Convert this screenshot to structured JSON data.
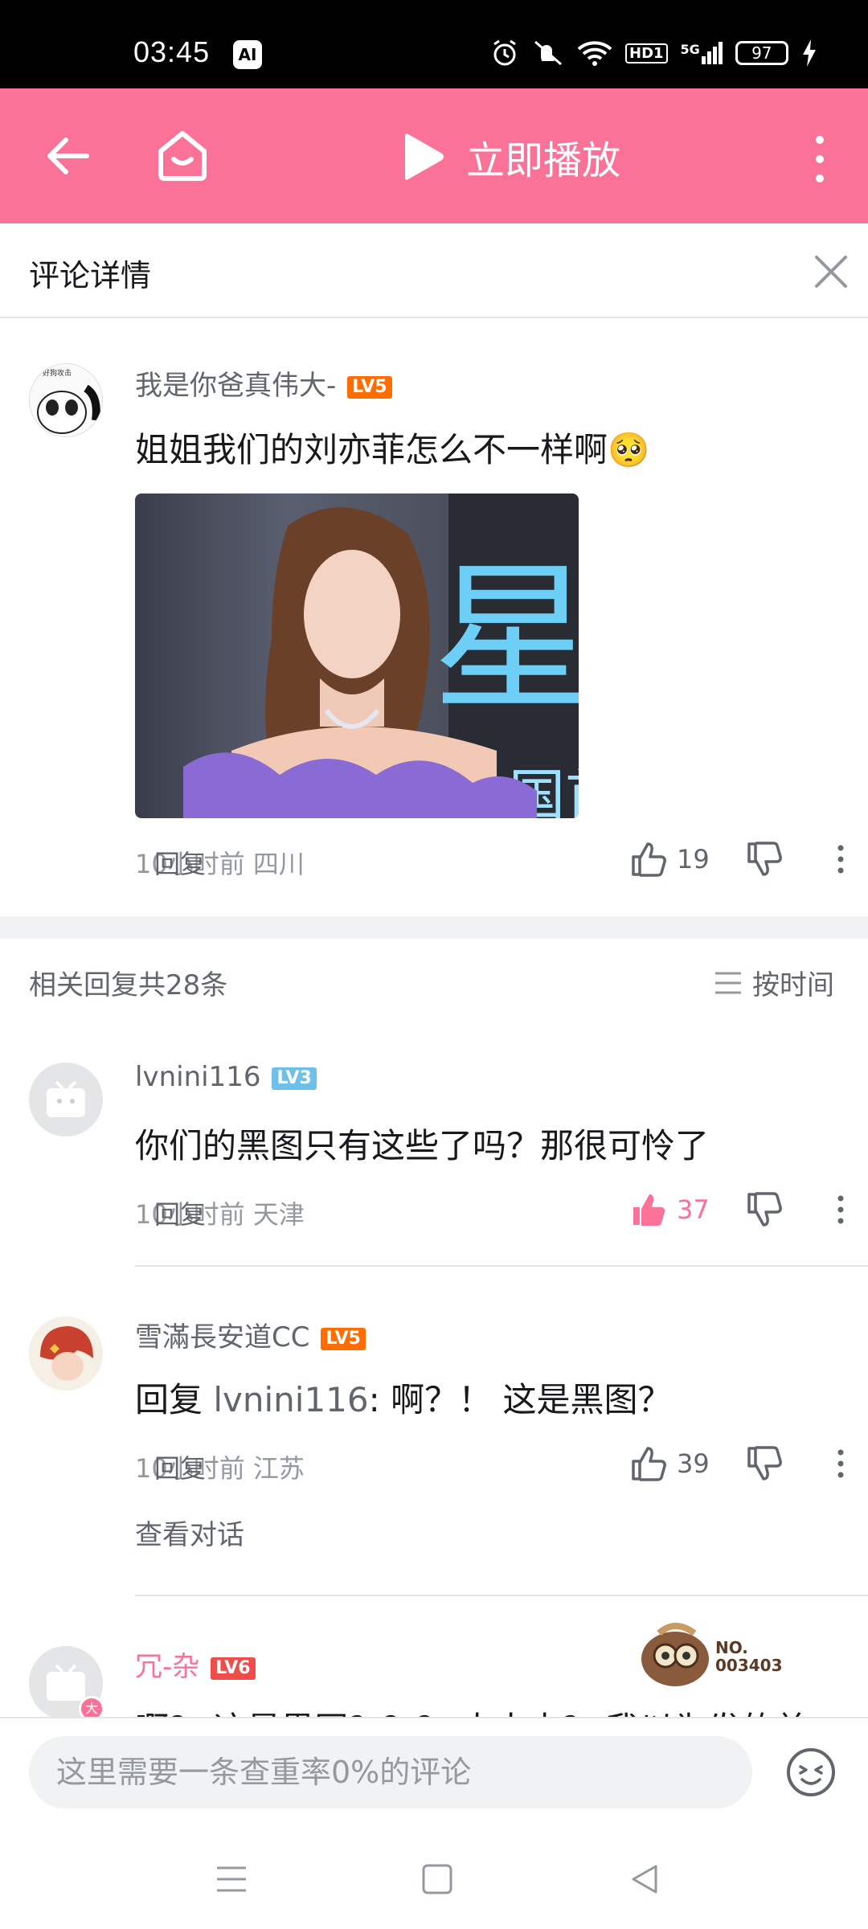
{
  "status_bar": {
    "time": "03:45",
    "ai_label": "AI",
    "network": "5G",
    "hd": "HD1",
    "battery": "97"
  },
  "topbar": {
    "play_label": "立即播放"
  },
  "header": {
    "title": "评论详情"
  },
  "main_comment": {
    "username": "我是你爸真伟大-",
    "level": "LV5",
    "text": "姐姐我们的刘亦菲怎么不一样啊🥺",
    "avatar_caption": "好狗攻击",
    "image_overlay_text": "星",
    "image_overlay_text2": "中国首",
    "time_location": "10小时前 四川",
    "reply_label": "回复",
    "likes": "19"
  },
  "replies_header": {
    "count_label": "相关回复共28条",
    "sort_label": "按时间"
  },
  "replies": [
    {
      "username": "lvnini116",
      "level": "LV3",
      "text": "你们的黑图只有这些了吗？那很可怜了",
      "time_location": "10小时前 天津",
      "reply_label": "回复",
      "likes": "37",
      "liked": true
    },
    {
      "username": "雪滿長安道CC",
      "level": "LV5",
      "reply_prefix": "回复 ",
      "mention": "lvnini116",
      "text": ": 啊？！ 这是黑图？",
      "time_location": "10小时前 江苏",
      "reply_label": "回复",
      "likes": "39",
      "view_conversation": "查看对话"
    },
    {
      "username": "冗-杂",
      "level": "LV6",
      "text": "啊？ 这是黑图？？？ 太太太？ 我以为发的美",
      "avatar_badge": "大",
      "badge_no": "NO.",
      "badge_number": "003403"
    }
  ],
  "input": {
    "placeholder": "这里需要一条查重率0%的评论"
  },
  "colors": {
    "brand_pink": "#fb7299",
    "lv5": "#ff6c00",
    "lv3": "#6dc1e8",
    "lv6": "#f04c49",
    "liked": "#fb7299"
  }
}
